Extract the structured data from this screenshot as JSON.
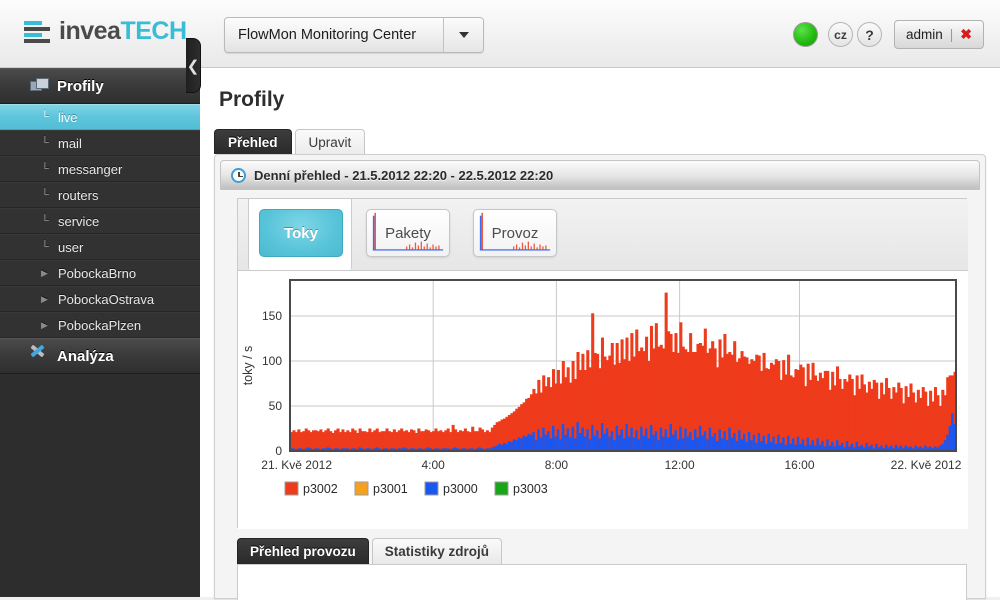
{
  "topbar": {
    "logo_primary": "invea",
    "logo_secondary": "TECH",
    "logo_icon": "bars-icon",
    "app_select_value": "FlowMon Monitoring Center",
    "app_select_arrow_icon": "chevron-down-icon",
    "status_icon": "status-green-dot",
    "lang_label": "cz",
    "help_label": "?",
    "user_label": "admin",
    "user_separator": "|",
    "user_close_icon": "✖"
  },
  "sidebar": {
    "sections": [
      {
        "title": "Profily",
        "icon": "monitors-icon",
        "items": [
          {
            "label": "live",
            "mark": "└",
            "active": true
          },
          {
            "label": "mail",
            "mark": "└",
            "active": false
          },
          {
            "label": "messanger",
            "mark": "└",
            "active": false
          },
          {
            "label": "routers",
            "mark": "└",
            "active": false
          },
          {
            "label": "service",
            "mark": "└",
            "active": false
          },
          {
            "label": "user",
            "mark": "└",
            "active": false
          },
          {
            "label": "PobockaBrno",
            "mark": "▶",
            "active": false
          },
          {
            "label": "PobockaOstrava",
            "mark": "▶",
            "active": false
          },
          {
            "label": "PobockaPlzen",
            "mark": "▶",
            "active": false
          }
        ]
      },
      {
        "title": "Analýza",
        "icon": "tools-icon",
        "items": []
      }
    ],
    "collapse_icon": "❮"
  },
  "main": {
    "page_title": "Profily",
    "tabs": [
      {
        "label": "Přehled",
        "active": true
      },
      {
        "label": "Upravit",
        "active": false
      }
    ],
    "panel_header": {
      "icon": "clock-icon",
      "title": "Denní přehled - 21.5.2012 22:20 - 22.5.2012 22:20"
    },
    "chart_tabs": [
      {
        "label": "Toky",
        "active": true
      },
      {
        "label": "Pakety",
        "active": false
      },
      {
        "label": "Provoz",
        "active": false
      }
    ],
    "bottom_tabs": [
      {
        "label": "Přehled provozu",
        "active": true
      },
      {
        "label": "Statistiky zdrojů",
        "active": false
      }
    ]
  },
  "chart_data": {
    "type": "area",
    "title": "",
    "xlabel": "",
    "ylabel": "toky / s",
    "ylim": [
      0,
      190
    ],
    "yticks": [
      0,
      50,
      100,
      150
    ],
    "ytick_labels": [
      "0",
      "50",
      "100",
      "150"
    ],
    "xtick_labels": [
      "21. Kvě 2012",
      "4:00",
      "8:00",
      "12:00",
      "16:00",
      "22. Kvě 2012"
    ],
    "xtick_positions": [
      0.01,
      0.215,
      0.4,
      0.585,
      0.765,
      0.955
    ],
    "grid": true,
    "stacked": true,
    "legend_position": "below",
    "series": [
      {
        "name": "p3002",
        "color": "#ee3b1b",
        "order": 2
      },
      {
        "name": "p3001",
        "color": "#f5a01e",
        "order": 3
      },
      {
        "name": "p3000",
        "color": "#1a56ef",
        "order": 1
      },
      {
        "name": "p3003",
        "color": "#18a618",
        "order": 4
      }
    ],
    "notes": "Stacked area: p3000 (blue) at base, p3002 (red) above. Quiet overnight ~18-25 flows/s until ~07:00, ramping to a busy daytime band 55-110 flows/s with peak ~152 near 10:40, declining after 17:00, with a final spike ~90 at the right edge.",
    "p3000_values": [
      3,
      3,
      2,
      3,
      3,
      2,
      3,
      4,
      3,
      2,
      3,
      3,
      2,
      3,
      3,
      4,
      3,
      2,
      3,
      3,
      2,
      3,
      3,
      3,
      2,
      3,
      3,
      2,
      4,
      3,
      2,
      3,
      3,
      2,
      3,
      4,
      3,
      2,
      3,
      3,
      2,
      3,
      3,
      2,
      3,
      3,
      4,
      3,
      2,
      3,
      3,
      2,
      3,
      3,
      2,
      3,
      4,
      3,
      2,
      3,
      3,
      2,
      3,
      3,
      3,
      2,
      3,
      4,
      3,
      2,
      3,
      3,
      2,
      3,
      3,
      2,
      3,
      4,
      3,
      2,
      3,
      3,
      4,
      5,
      6,
      8,
      7,
      9,
      8,
      11,
      10,
      13,
      12,
      15,
      14,
      17,
      16,
      19,
      18,
      21,
      12,
      24,
      15,
      26,
      18,
      22,
      14,
      28,
      16,
      24,
      13,
      30,
      18,
      25,
      15,
      27,
      14,
      32,
      20,
      26,
      16,
      24,
      13,
      29,
      17,
      23,
      14,
      31,
      19,
      25,
      16,
      22,
      12,
      28,
      18,
      24,
      14,
      30,
      16,
      26,
      15,
      23,
      13,
      27,
      17,
      25,
      14,
      29,
      18,
      22,
      12,
      26,
      16,
      24,
      15,
      30,
      18,
      23,
      13,
      27,
      14,
      25,
      16,
      21,
      12,
      24,
      15,
      28,
      17,
      22,
      13,
      26,
      16,
      20,
      11,
      24,
      14,
      22,
      12,
      26,
      15,
      20,
      11,
      23,
      13,
      19,
      10,
      21,
      12,
      18,
      9,
      20,
      11,
      17,
      8,
      19,
      10,
      16,
      8,
      18,
      9,
      15,
      7,
      17,
      8,
      14,
      7,
      16,
      8,
      13,
      6,
      15,
      7,
      12,
      6,
      14,
      7,
      11,
      5,
      13,
      6,
      10,
      5,
      12,
      6,
      9,
      4,
      11,
      5,
      8,
      4,
      10,
      5,
      7,
      4,
      9,
      5,
      7,
      3,
      8,
      4,
      6,
      3,
      7,
      4,
      6,
      3,
      7,
      4,
      6,
      3,
      6,
      4,
      5,
      3,
      6,
      4,
      5,
      3,
      6,
      4,
      5,
      3,
      5,
      4,
      6,
      8,
      12,
      18,
      28,
      42,
      30
    ],
    "p3002_values": [
      18,
      20,
      19,
      21,
      18,
      20,
      22,
      19,
      18,
      21,
      20,
      19,
      22,
      18,
      20,
      21,
      19,
      18,
      20,
      22,
      19,
      21,
      18,
      20,
      19,
      22,
      20,
      18,
      21,
      19,
      20,
      18,
      22,
      19,
      20,
      21,
      18,
      20,
      19,
      22,
      20,
      18,
      21,
      19,
      20,
      22,
      18,
      20,
      19,
      21,
      20,
      18,
      22,
      19,
      20,
      21,
      19,
      18,
      20,
      22,
      19,
      21,
      18,
      20,
      22,
      19,
      26,
      20,
      18,
      21,
      19,
      22,
      20,
      18,
      24,
      20,
      19,
      22,
      21,
      19,
      20,
      18,
      22,
      24,
      26,
      25,
      28,
      27,
      30,
      29,
      32,
      31,
      35,
      34,
      38,
      37,
      42,
      40,
      45,
      48,
      52,
      55,
      50,
      58,
      54,
      60,
      57,
      63,
      59,
      66,
      62,
      70,
      64,
      68,
      61,
      73,
      66,
      78,
      70,
      82,
      74,
      88,
      80,
      124,
      92,
      85,
      78,
      95,
      86,
      76,
      90,
      98,
      84,
      92,
      80,
      100,
      88,
      96,
      84,
      105,
      90,
      112,
      98,
      88,
      94,
      102,
      86,
      110,
      96,
      120,
      104,
      92,
      98,
      152,
      118,
      100,
      92,
      108,
      96,
      116,
      102,
      88,
      94,
      110,
      98,
      86,
      104,
      92,
      100,
      114,
      96,
      88,
      106,
      94,
      82,
      100,
      90,
      108,
      96,
      84,
      92,
      102,
      88,
      80,
      98,
      86,
      94,
      76,
      90,
      82,
      98,
      86,
      78,
      92,
      84,
      72,
      88,
      80,
      94,
      82,
      70,
      86,
      78,
      90,
      76,
      68,
      84,
      74,
      88,
      80,
      66,
      82,
      72,
      86,
      78,
      64,
      80,
      70,
      84,
      76,
      62,
      78,
      68,
      82,
      74,
      60,
      76,
      66,
      80,
      72,
      58,
      74,
      64,
      78,
      70,
      56,
      72,
      62,
      76,
      68,
      54,
      70,
      60,
      74,
      66,
      52,
      68,
      58,
      72,
      64,
      50,
      66,
      56,
      70,
      62,
      48,
      64,
      54,
      68,
      60,
      46,
      62,
      52,
      66,
      58,
      44,
      60,
      50,
      64,
      56,
      42,
      58,
      48,
      62,
      54,
      40,
      56,
      46,
      60,
      52,
      38,
      54,
      44,
      58,
      50,
      36,
      52,
      42,
      56,
      48,
      50,
      60,
      72,
      88,
      62
    ]
  }
}
